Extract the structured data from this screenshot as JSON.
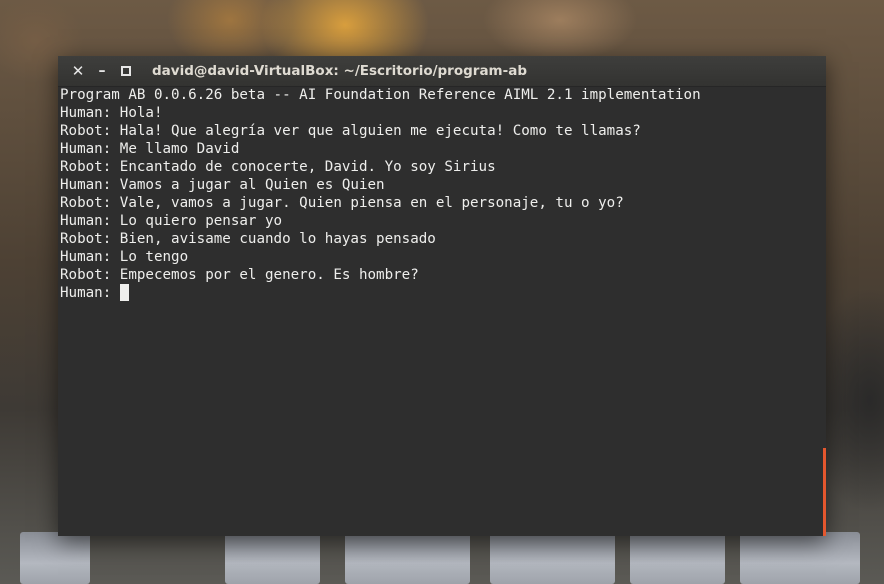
{
  "window": {
    "title": "david@david-VirtualBox: ~/Escritorio/program-ab",
    "controls": [
      "close-icon",
      "minimize-icon",
      "maximize-icon"
    ]
  },
  "terminal": {
    "lines": [
      "Program AB 0.0.6.26 beta -- AI Foundation Reference AIML 2.1 implementation",
      "Human: Hola!",
      "Robot: Hala! Que alegría ver que alguien me ejecuta! Como te llamas?",
      "Human: Me llamo David",
      "Robot: Encantado de conocerte, David. Yo soy Sirius",
      "Human: Vamos a jugar al Quien es Quien",
      "Robot: Vale, vamos a jugar. Quien piensa en el personaje, tu o yo?",
      "Human: Lo quiero pensar yo",
      "Robot: Bien, avisame cuando lo hayas pensado",
      "Human: Lo tengo",
      "Robot: Empecemos por el genero. Es hombre?"
    ],
    "prompt": "Human: "
  },
  "colors": {
    "terminal_bg": "#2e2e2e",
    "terminal_fg": "#eeeeec",
    "scrollbar_accent": "#e4572e"
  }
}
